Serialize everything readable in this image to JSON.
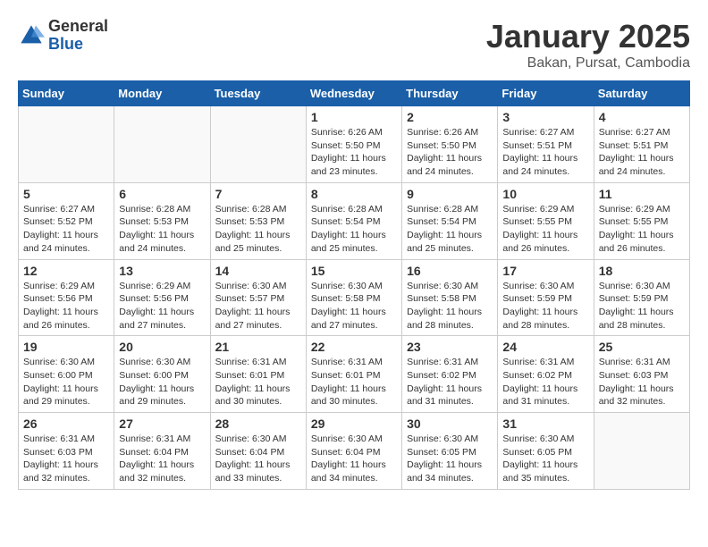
{
  "logo": {
    "general": "General",
    "blue": "Blue"
  },
  "header": {
    "title": "January 2025",
    "subtitle": "Bakan, Pursat, Cambodia"
  },
  "weekdays": [
    "Sunday",
    "Monday",
    "Tuesday",
    "Wednesday",
    "Thursday",
    "Friday",
    "Saturday"
  ],
  "weeks": [
    [
      {
        "day": "",
        "info": ""
      },
      {
        "day": "",
        "info": ""
      },
      {
        "day": "",
        "info": ""
      },
      {
        "day": "1",
        "info": "Sunrise: 6:26 AM\nSunset: 5:50 PM\nDaylight: 11 hours\nand 23 minutes."
      },
      {
        "day": "2",
        "info": "Sunrise: 6:26 AM\nSunset: 5:50 PM\nDaylight: 11 hours\nand 24 minutes."
      },
      {
        "day": "3",
        "info": "Sunrise: 6:27 AM\nSunset: 5:51 PM\nDaylight: 11 hours\nand 24 minutes."
      },
      {
        "day": "4",
        "info": "Sunrise: 6:27 AM\nSunset: 5:51 PM\nDaylight: 11 hours\nand 24 minutes."
      }
    ],
    [
      {
        "day": "5",
        "info": "Sunrise: 6:27 AM\nSunset: 5:52 PM\nDaylight: 11 hours\nand 24 minutes."
      },
      {
        "day": "6",
        "info": "Sunrise: 6:28 AM\nSunset: 5:53 PM\nDaylight: 11 hours\nand 24 minutes."
      },
      {
        "day": "7",
        "info": "Sunrise: 6:28 AM\nSunset: 5:53 PM\nDaylight: 11 hours\nand 25 minutes."
      },
      {
        "day": "8",
        "info": "Sunrise: 6:28 AM\nSunset: 5:54 PM\nDaylight: 11 hours\nand 25 minutes."
      },
      {
        "day": "9",
        "info": "Sunrise: 6:28 AM\nSunset: 5:54 PM\nDaylight: 11 hours\nand 25 minutes."
      },
      {
        "day": "10",
        "info": "Sunrise: 6:29 AM\nSunset: 5:55 PM\nDaylight: 11 hours\nand 26 minutes."
      },
      {
        "day": "11",
        "info": "Sunrise: 6:29 AM\nSunset: 5:55 PM\nDaylight: 11 hours\nand 26 minutes."
      }
    ],
    [
      {
        "day": "12",
        "info": "Sunrise: 6:29 AM\nSunset: 5:56 PM\nDaylight: 11 hours\nand 26 minutes."
      },
      {
        "day": "13",
        "info": "Sunrise: 6:29 AM\nSunset: 5:56 PM\nDaylight: 11 hours\nand 27 minutes."
      },
      {
        "day": "14",
        "info": "Sunrise: 6:30 AM\nSunset: 5:57 PM\nDaylight: 11 hours\nand 27 minutes."
      },
      {
        "day": "15",
        "info": "Sunrise: 6:30 AM\nSunset: 5:58 PM\nDaylight: 11 hours\nand 27 minutes."
      },
      {
        "day": "16",
        "info": "Sunrise: 6:30 AM\nSunset: 5:58 PM\nDaylight: 11 hours\nand 28 minutes."
      },
      {
        "day": "17",
        "info": "Sunrise: 6:30 AM\nSunset: 5:59 PM\nDaylight: 11 hours\nand 28 minutes."
      },
      {
        "day": "18",
        "info": "Sunrise: 6:30 AM\nSunset: 5:59 PM\nDaylight: 11 hours\nand 28 minutes."
      }
    ],
    [
      {
        "day": "19",
        "info": "Sunrise: 6:30 AM\nSunset: 6:00 PM\nDaylight: 11 hours\nand 29 minutes."
      },
      {
        "day": "20",
        "info": "Sunrise: 6:30 AM\nSunset: 6:00 PM\nDaylight: 11 hours\nand 29 minutes."
      },
      {
        "day": "21",
        "info": "Sunrise: 6:31 AM\nSunset: 6:01 PM\nDaylight: 11 hours\nand 30 minutes."
      },
      {
        "day": "22",
        "info": "Sunrise: 6:31 AM\nSunset: 6:01 PM\nDaylight: 11 hours\nand 30 minutes."
      },
      {
        "day": "23",
        "info": "Sunrise: 6:31 AM\nSunset: 6:02 PM\nDaylight: 11 hours\nand 31 minutes."
      },
      {
        "day": "24",
        "info": "Sunrise: 6:31 AM\nSunset: 6:02 PM\nDaylight: 11 hours\nand 31 minutes."
      },
      {
        "day": "25",
        "info": "Sunrise: 6:31 AM\nSunset: 6:03 PM\nDaylight: 11 hours\nand 32 minutes."
      }
    ],
    [
      {
        "day": "26",
        "info": "Sunrise: 6:31 AM\nSunset: 6:03 PM\nDaylight: 11 hours\nand 32 minutes."
      },
      {
        "day": "27",
        "info": "Sunrise: 6:31 AM\nSunset: 6:04 PM\nDaylight: 11 hours\nand 32 minutes."
      },
      {
        "day": "28",
        "info": "Sunrise: 6:30 AM\nSunset: 6:04 PM\nDaylight: 11 hours\nand 33 minutes."
      },
      {
        "day": "29",
        "info": "Sunrise: 6:30 AM\nSunset: 6:04 PM\nDaylight: 11 hours\nand 34 minutes."
      },
      {
        "day": "30",
        "info": "Sunrise: 6:30 AM\nSunset: 6:05 PM\nDaylight: 11 hours\nand 34 minutes."
      },
      {
        "day": "31",
        "info": "Sunrise: 6:30 AM\nSunset: 6:05 PM\nDaylight: 11 hours\nand 35 minutes."
      },
      {
        "day": "",
        "info": ""
      }
    ]
  ]
}
